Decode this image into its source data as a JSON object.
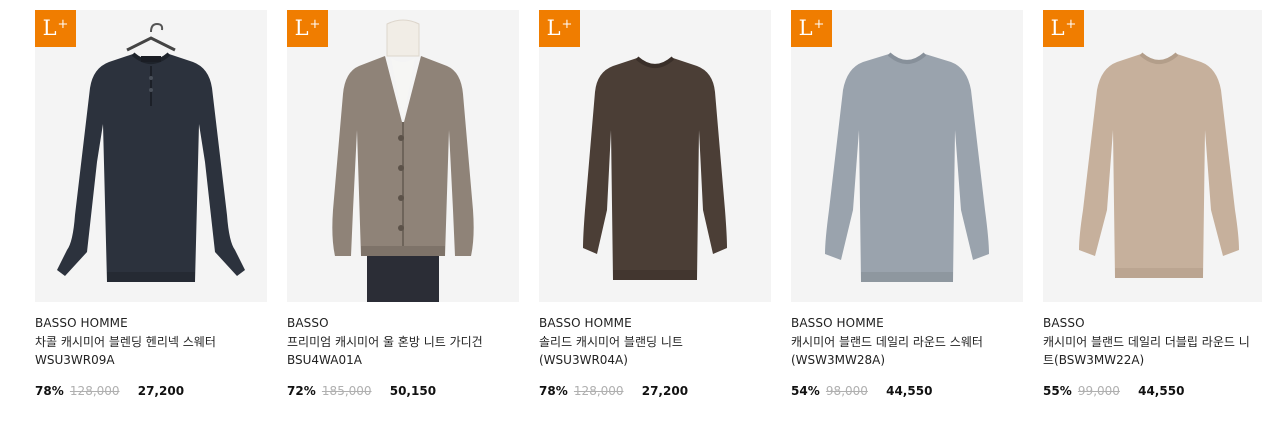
{
  "badge": {
    "label": "L",
    "sup": "+"
  },
  "products": [
    {
      "brand": "BASSO HOMME",
      "name": "차콜 캐시미어 블렌딩 헨리넥 스웨터 WSU3WR09A",
      "discount": "78%",
      "original_price": "128,000",
      "sale_price": "27,200",
      "color": "#2c323d",
      "style": "henley-on-hanger"
    },
    {
      "brand": "BASSO",
      "name": "프리미엄 캐시미어 울 혼방 니트 가디건 BSU4WA01A",
      "discount": "72%",
      "original_price": "185,000",
      "sale_price": "50,150",
      "color": "#8f8378",
      "style": "cardigan-on-mannequin"
    },
    {
      "brand": "BASSO HOMME",
      "name": "솔리드 캐시미어 블랜딩 니트(WSU3WR04A)",
      "discount": "78%",
      "original_price": "128,000",
      "sale_price": "27,200",
      "color": "#4b3e36",
      "style": "crewneck"
    },
    {
      "brand": "BASSO HOMME",
      "name": "캐시미어 블랜드 데일리 라운드 스웨터(WSW3MW28A)",
      "discount": "54%",
      "original_price": "98,000",
      "sale_price": "44,550",
      "color": "#9aa3ad",
      "style": "crewneck"
    },
    {
      "brand": "BASSO",
      "name": "캐시미어 블랜드 데일리 더블립 라운드 니트(BSW3MW22A)",
      "discount": "55%",
      "original_price": "99,000",
      "sale_price": "44,550",
      "color": "#c6b09c",
      "style": "crewneck"
    }
  ]
}
